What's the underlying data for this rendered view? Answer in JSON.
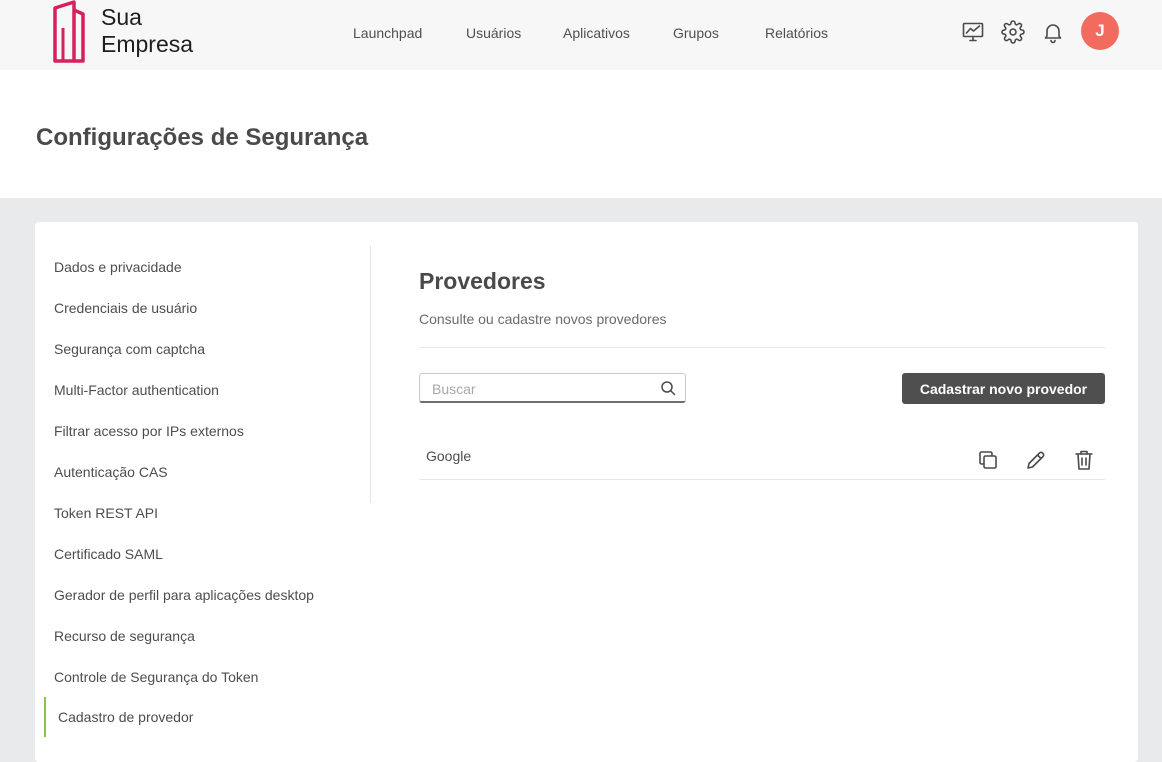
{
  "brand": {
    "line1": "Sua",
    "line2": "Empresa",
    "color": "#d6205f"
  },
  "nav": {
    "items": [
      {
        "label": "Launchpad"
      },
      {
        "label": "Usuários"
      },
      {
        "label": "Aplicativos"
      },
      {
        "label": "Grupos"
      },
      {
        "label": "Relatórios"
      }
    ],
    "icons": [
      "monitor-chart-icon",
      "gear-icon",
      "bell-icon"
    ],
    "avatar_initial": "J",
    "avatar_color": "#f26b5f"
  },
  "page": {
    "title": "Configurações de Segurança"
  },
  "sidebar": {
    "items": [
      {
        "label": "Dados e privacidade"
      },
      {
        "label": "Credenciais de usuário"
      },
      {
        "label": "Segurança com captcha"
      },
      {
        "label": "Multi-Factor authentication"
      },
      {
        "label": "Filtrar acesso por IPs externos"
      },
      {
        "label": "Autenticação CAS"
      },
      {
        "label": "Token REST API"
      },
      {
        "label": "Certificado SAML"
      },
      {
        "label": "Gerador de perfil para aplicações desktop"
      },
      {
        "label": "Recurso de segurança"
      },
      {
        "label": "Controle de Segurança do Token"
      },
      {
        "label": "Cadastro de provedor",
        "active": true
      }
    ],
    "active_color": "#8cc63f"
  },
  "content": {
    "title": "Provedores",
    "subtitle": "Consulte ou cadastre novos provedores",
    "search": {
      "placeholder": "Buscar",
      "value": ""
    },
    "new_button_label": "Cadastrar novo provedor",
    "providers": [
      {
        "name": "Google",
        "actions": [
          "copy-icon",
          "edit-pencil-icon",
          "trash-icon"
        ]
      }
    ]
  }
}
